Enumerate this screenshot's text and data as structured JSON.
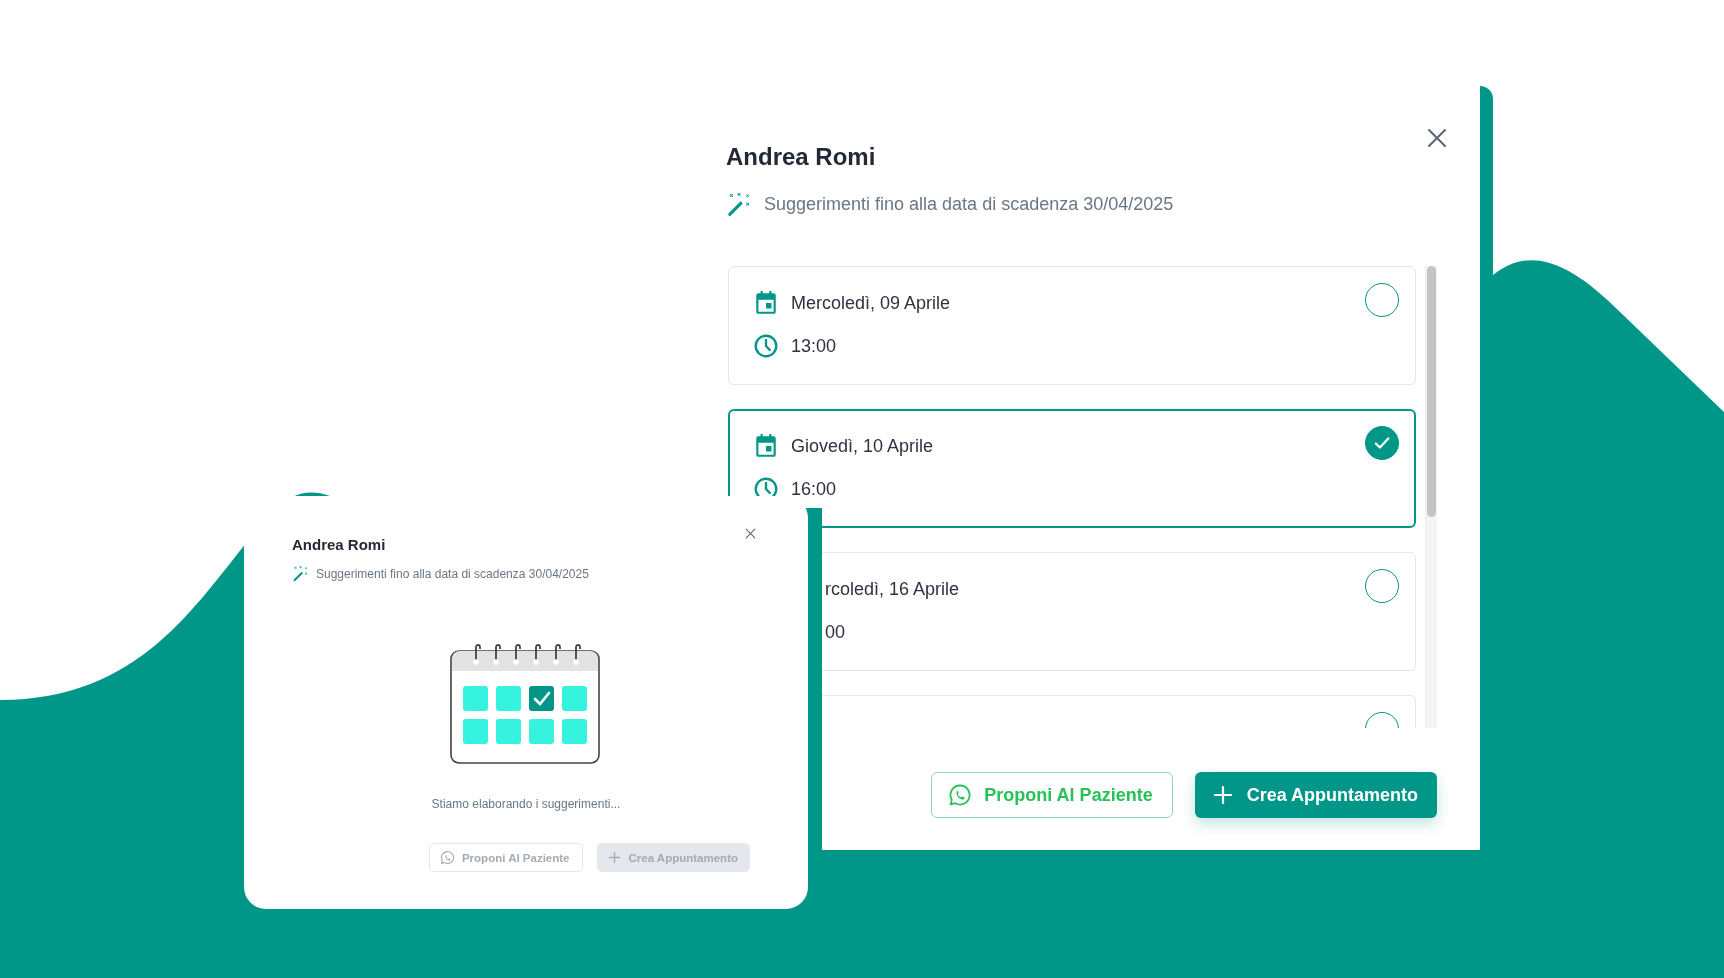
{
  "main_dialog": {
    "title": "Andrea Romi",
    "subtitle": "Suggerimenti fino alla data di scadenza 30/04/2025",
    "slots": [
      {
        "kind": "full",
        "date": "Mercoledì, 09 Aprile",
        "time": "13:00",
        "selected": false
      },
      {
        "kind": "full",
        "date": "Giovedì, 10 Aprile",
        "time": "16:00",
        "selected": true
      },
      {
        "kind": "cut",
        "date": "rcoledì, 16 Aprile",
        "time": "00",
        "selected": false
      },
      {
        "kind": "cut",
        "selected": false
      }
    ],
    "buttons": [
      {
        "kind": "whatsapp",
        "label": "Proponi Al Paziente",
        "disabled": false
      },
      {
        "kind": "create",
        "label": "Crea Appuntamento",
        "disabled": false
      }
    ]
  },
  "loading_dialog": {
    "title": "Andrea Romi",
    "subtitle": "Suggerimenti fino alla data di scadenza 30/04/2025",
    "message": "Stiamo elaborando i suggerimenti...",
    "buttons": [
      {
        "kind": "whatsapp",
        "label": "Proponi Al Paziente",
        "disabled": true
      },
      {
        "kind": "create",
        "label": "Crea Appuntamento",
        "disabled": true
      }
    ]
  }
}
